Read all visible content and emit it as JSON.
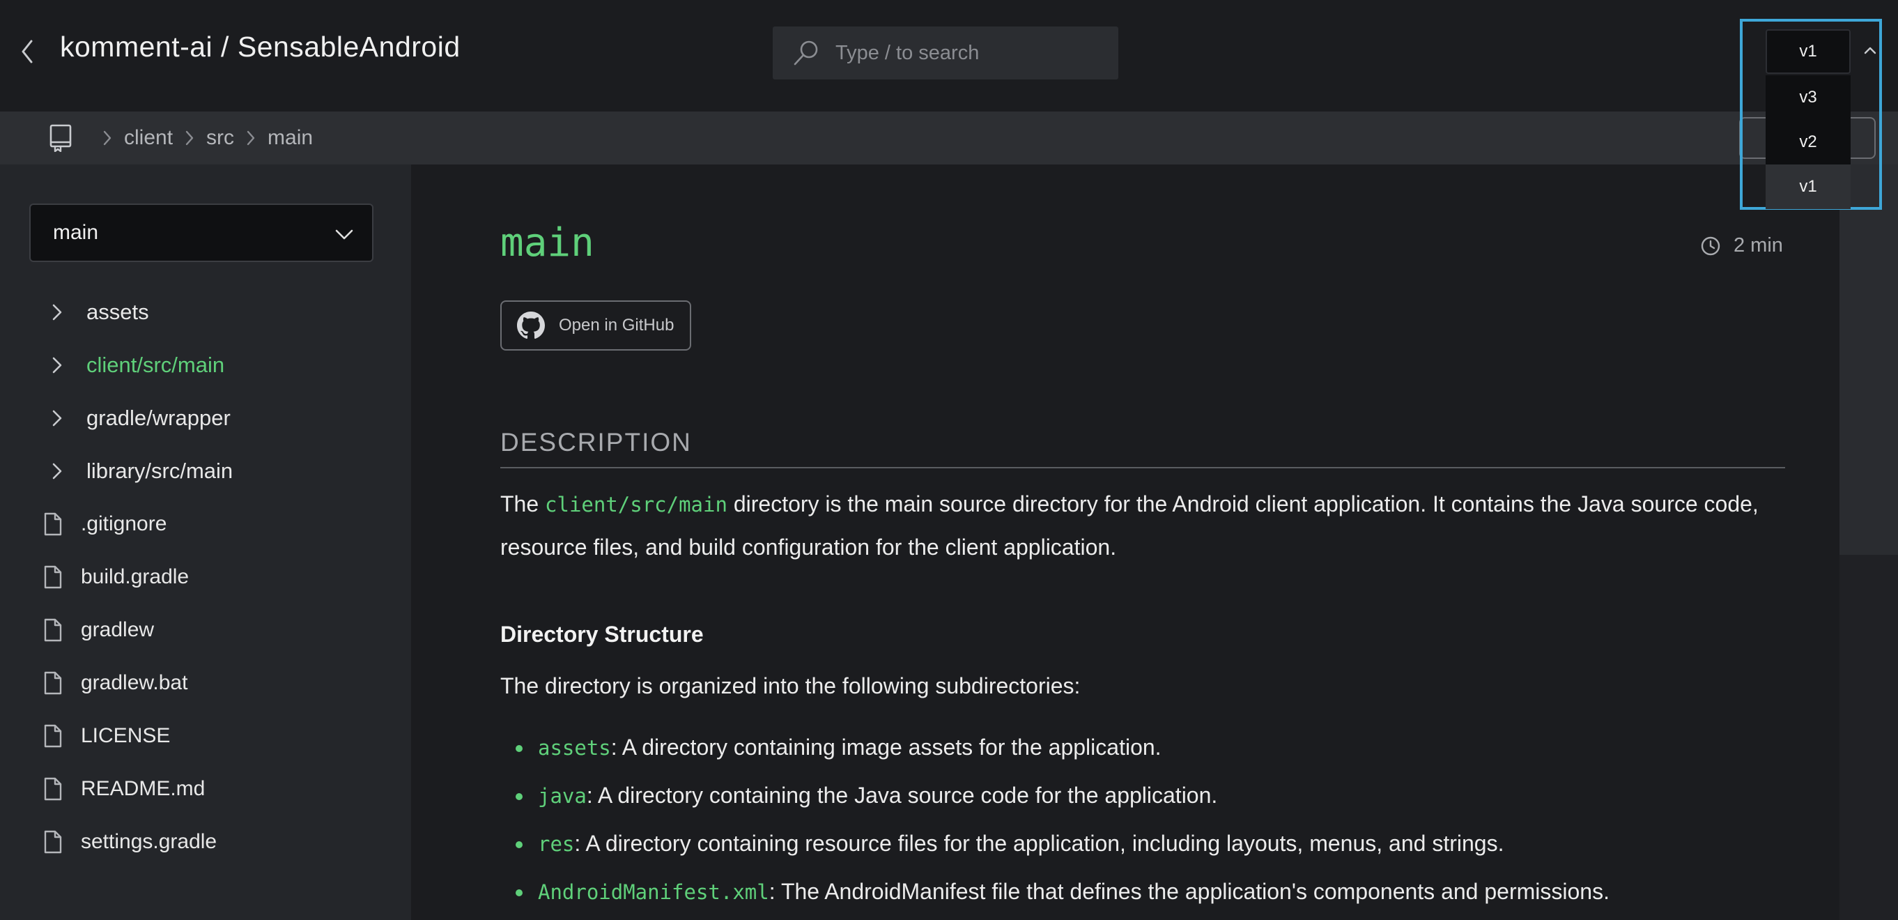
{
  "header": {
    "title": "komment-ai / SensableAndroid",
    "search_placeholder": "Type / to search"
  },
  "breadcrumb": [
    "client",
    "src",
    "main"
  ],
  "sidebar": {
    "branch": "main",
    "folders": [
      {
        "label": "assets",
        "active": false
      },
      {
        "label": "client/src/main",
        "active": true
      },
      {
        "label": "gradle/wrapper",
        "active": false
      },
      {
        "label": "library/src/main",
        "active": false
      }
    ],
    "files": [
      ".gitignore",
      "build.gradle",
      "gradlew",
      "gradlew.bat",
      "LICENSE",
      "README.md",
      "settings.gradle"
    ]
  },
  "main": {
    "title": "main",
    "read_time": "2 min",
    "github_button": "Open in GitHub",
    "section_heading": "DESCRIPTION",
    "description_before": "The",
    "description_code": "client/src/main",
    "description_after": "directory is the main source directory for the Android client application. It contains the Java source code, resource files, and build configuration for the client application.",
    "subheading": "Directory Structure",
    "intro": "The directory is organized into the following subdirectories:",
    "items": [
      {
        "code": "assets",
        "text": ": A directory containing image assets for the application."
      },
      {
        "code": "java",
        "text": ": A directory containing the Java source code for the application."
      },
      {
        "code": "res",
        "text": ": A directory containing resource files for the application, including layouts, menus, and strings."
      },
      {
        "code": "AndroidManifest.xml",
        "text": ": The AndroidManifest file that defines the application's components and permissions."
      }
    ]
  },
  "version_dropdown": {
    "current": "v1",
    "options": [
      "v3",
      "v2",
      "v1"
    ],
    "selected": "v1"
  },
  "colors": {
    "accent": "#5fd07a",
    "focus_outline": "#3ea7d8"
  }
}
